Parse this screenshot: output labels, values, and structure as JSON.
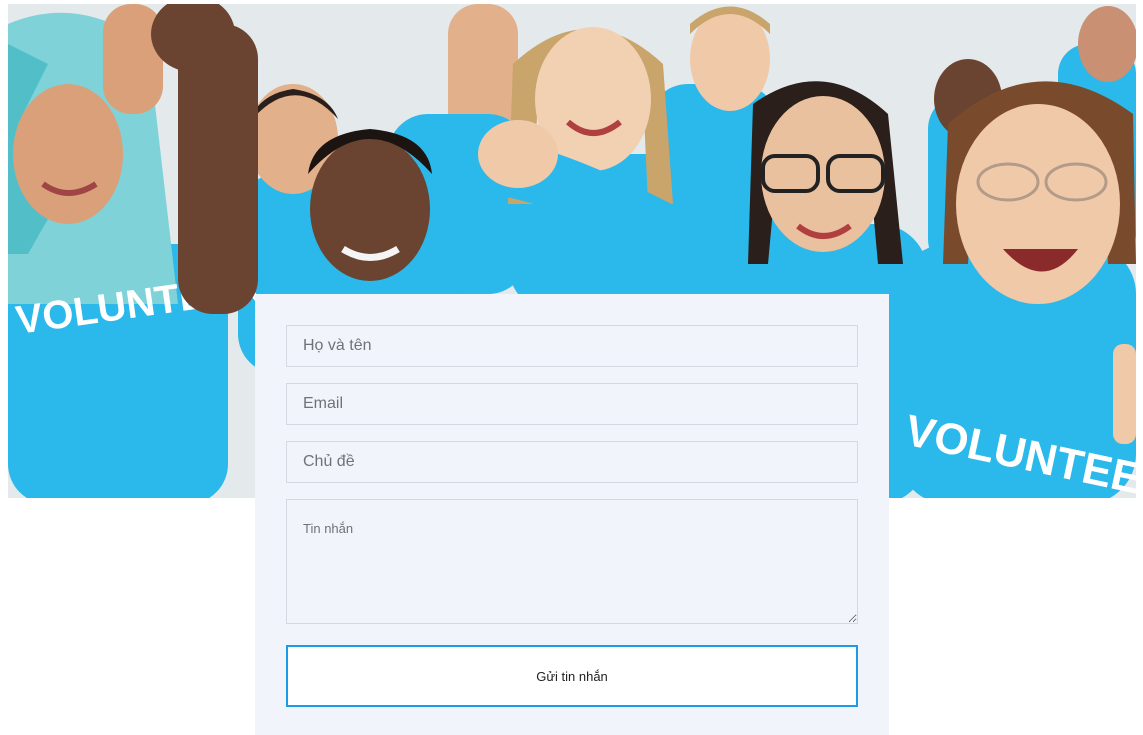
{
  "hero": {
    "shirt_text": "VOLUNTEER",
    "colors": {
      "shirt": "#2bb8ea",
      "background": "#e4e9ec",
      "skin_light": "#f0c9a8",
      "skin_medium": "#d9a07a",
      "skin_dark": "#6a4431",
      "hair_dark": "#2a1f1a",
      "hair_blonde": "#c9a46b",
      "hijab": "#7fd3d8"
    }
  },
  "form": {
    "name_placeholder": "Họ và tên",
    "email_placeholder": "Email",
    "subject_placeholder": "Chủ đề",
    "message_placeholder": "Tin nhắn",
    "submit_label": "Gửi tin nhắn",
    "colors": {
      "card_background": "#f2f4fc",
      "field_border": "#d4d8e2",
      "button_border": "#1e9be6"
    }
  }
}
